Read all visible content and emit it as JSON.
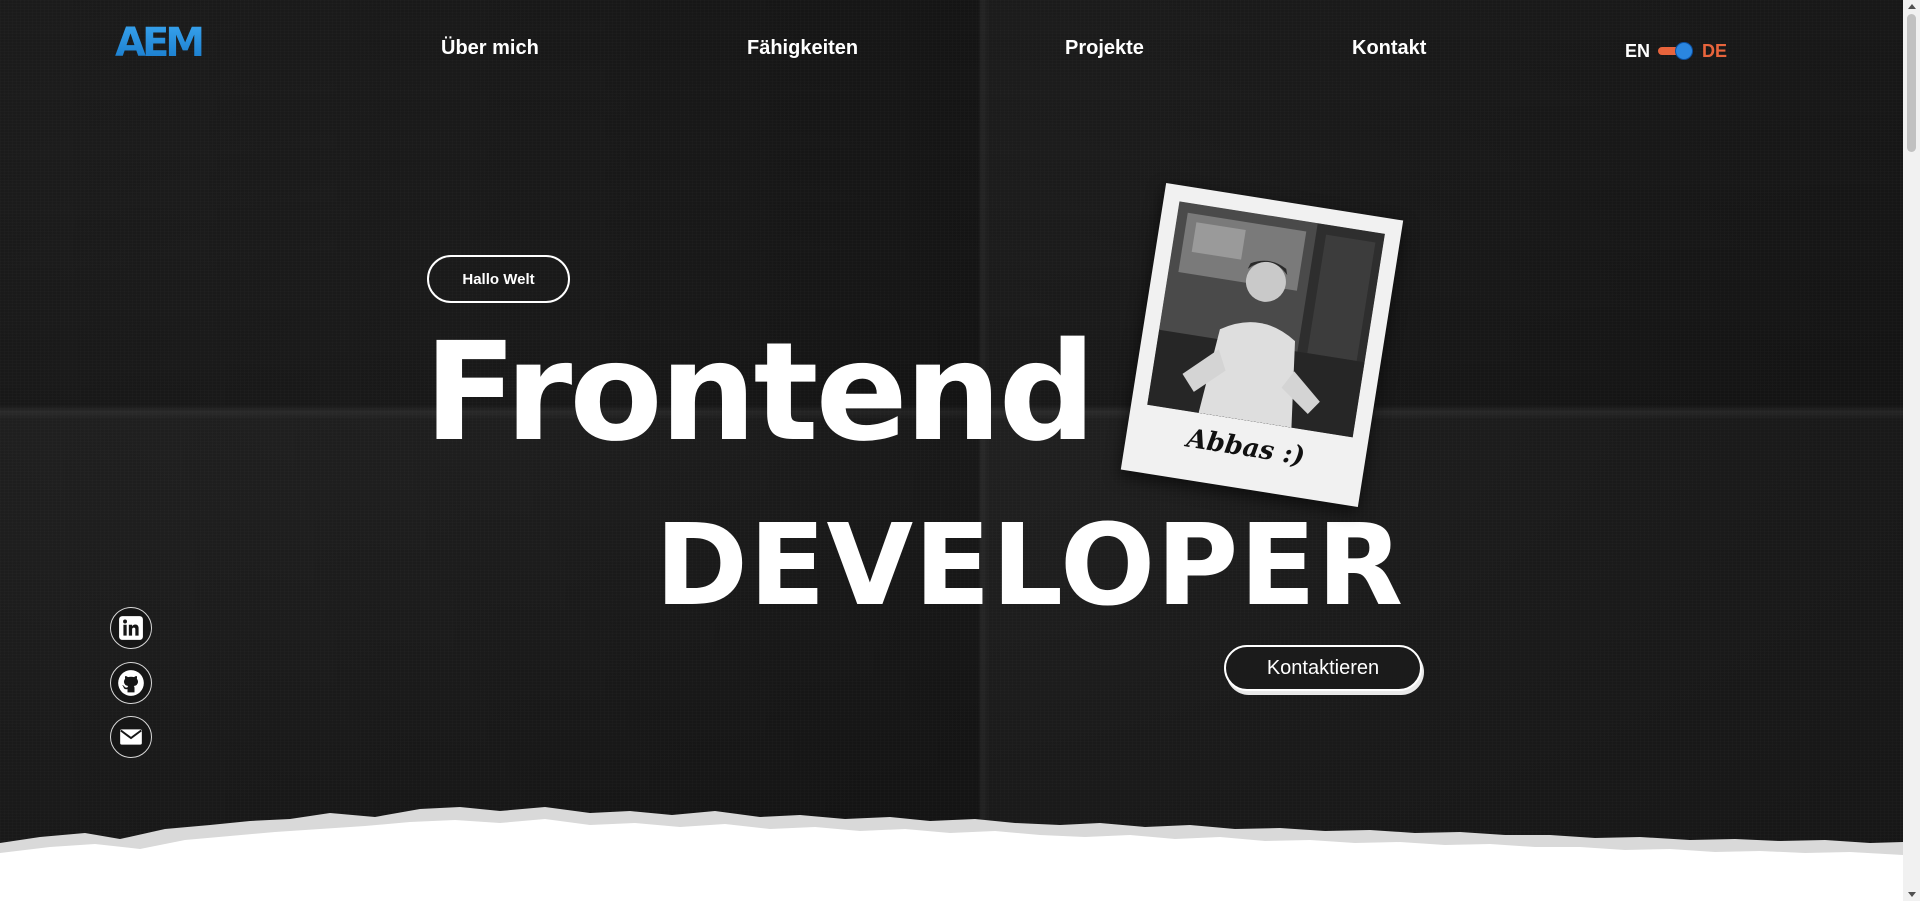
{
  "header": {
    "logo_text": "AEM",
    "nav": [
      {
        "label": "Über mich"
      },
      {
        "label": "Fähigkeiten"
      },
      {
        "label": "Projekte"
      },
      {
        "label": "Kontakt"
      }
    ],
    "language": {
      "left": "EN",
      "right": "DE",
      "active": "DE"
    }
  },
  "hero": {
    "greeting": "Hallo Welt",
    "title_line1": "Frontend",
    "title_line2": "DEVELOPER",
    "cta_label": "Kontaktieren",
    "photo_caption": "Abbas :)"
  },
  "social": [
    {
      "icon": "linkedin-icon"
    },
    {
      "icon": "github-icon"
    },
    {
      "icon": "mail-icon"
    }
  ],
  "colors": {
    "background": "#1c1c1c",
    "accent_blue": "#2a86e0",
    "accent_orange": "#e8643c",
    "text": "#ffffff"
  }
}
